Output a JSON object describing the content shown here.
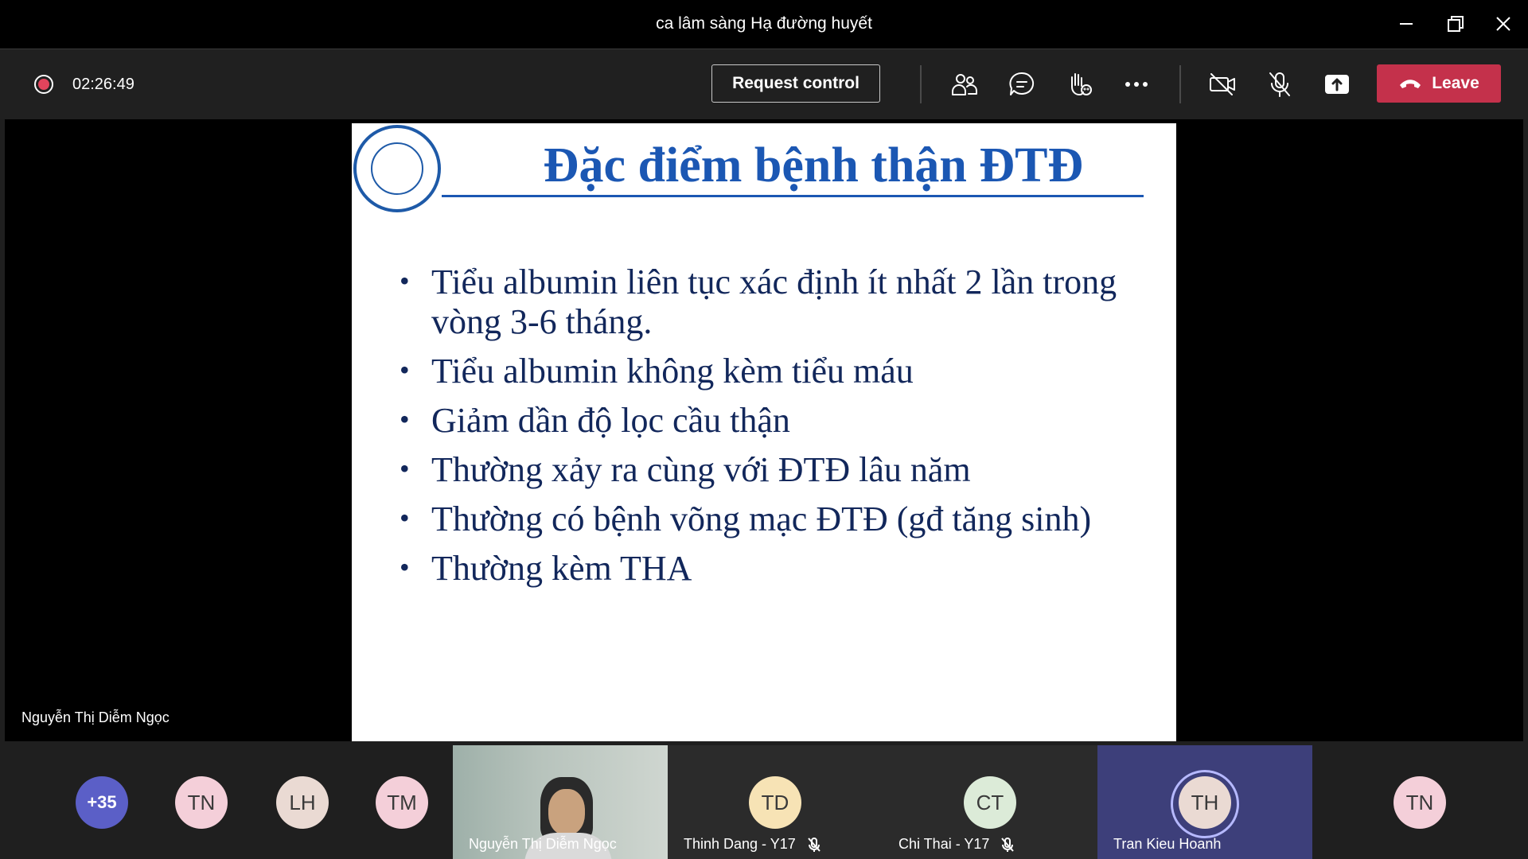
{
  "window": {
    "title": "ca lâm sàng Hạ đường huyết"
  },
  "toolbar": {
    "timer": "02:26:49",
    "request_control_label": "Request control",
    "leave_label": "Leave"
  },
  "slide": {
    "title": "Đặc điểm bệnh thận ĐTĐ",
    "bullets": [
      "Tiểu albumin liên tục xác định ít nhất 2 lần trong vòng 3-6 tháng.",
      "Tiểu albumin không kèm tiểu máu",
      "Giảm dần độ lọc cầu thận",
      "Thường xảy ra cùng với ĐTĐ lâu năm",
      "Thường có bệnh võng mạc ĐTĐ (gđ tăng sinh)",
      "Thường kèm THA"
    ]
  },
  "presenter": {
    "name": "Nguyễn Thị Diễm Ngọc"
  },
  "participants": {
    "overflow": "+35",
    "avatars": [
      {
        "initials": "TN",
        "color": "#f4cfd9"
      },
      {
        "initials": "LH",
        "color": "#eadad3"
      },
      {
        "initials": "TM",
        "color": "#f4cfd9"
      }
    ],
    "tiles": [
      {
        "name": "Nguyễn Thị Diễm Ngọc"
      },
      {
        "initials": "TD",
        "name": "Thinh Dang - Y17",
        "color": "#f7e3b5"
      },
      {
        "initials": "CT",
        "name": "Chi Thai - Y17",
        "color": "#dcebd8"
      },
      {
        "initials": "TH",
        "name": "Tran Kieu Hoanh",
        "color": "#eadad3"
      }
    ],
    "last_avatar": {
      "initials": "TN",
      "color": "#f4cfd9"
    }
  }
}
